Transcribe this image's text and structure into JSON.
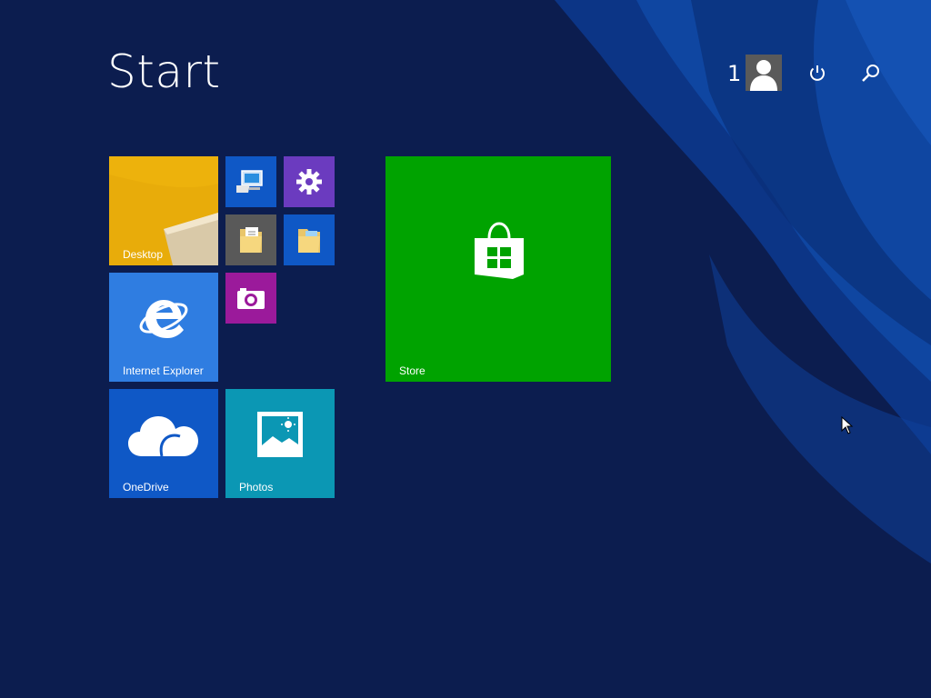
{
  "header": {
    "title": "Start",
    "user_name": "1"
  },
  "icons": {
    "avatar": "user-silhouette-icon",
    "power": "power-icon",
    "search": "search-icon"
  },
  "tiles": {
    "desktop": {
      "label": "Desktop",
      "color": "#e8ac0a"
    },
    "ie": {
      "label": "Internet Explorer",
      "color": "#2f7de1"
    },
    "onedrive": {
      "label": "OneDrive",
      "color": "#0f58c6"
    },
    "photos": {
      "label": "Photos",
      "color": "#0b97b4"
    },
    "store": {
      "label": "Store",
      "color": "#00a300"
    },
    "this_pc": {
      "icon": "computer-icon",
      "color": "#0f58c6"
    },
    "pc_settings": {
      "icon": "gear-icon",
      "color": "#6b3bbf"
    },
    "documents": {
      "icon": "documents-folder-icon",
      "color": "#595959"
    },
    "file_explorer": {
      "icon": "folder-icon",
      "color": "#0f58c6"
    },
    "camera": {
      "icon": "camera-icon",
      "color": "#9b1a9b"
    }
  },
  "background_color": "#0c1d4f"
}
